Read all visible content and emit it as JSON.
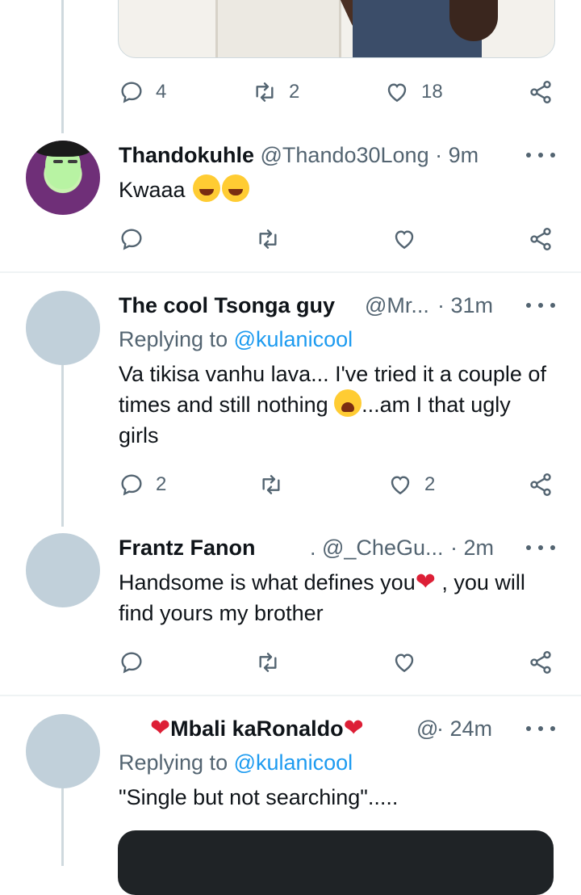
{
  "tweets": [
    {
      "actions": {
        "reply_count": "4",
        "retweet_count": "2",
        "like_count": "18"
      }
    },
    {
      "display_name": "Thandokuhle",
      "handle": "@Thando30Long",
      "time": "· 9m",
      "text": "Kwaaa",
      "emoji": "grinning-squinting-face-emoji",
      "actions": {
        "reply_count": "",
        "retweet_count": "",
        "like_count": ""
      }
    },
    {
      "display_name": "The cool Tsonga guy",
      "handle": "@Mr...",
      "time": "· 31m",
      "replying_to_label": "Replying to",
      "replying_to": "@kulanicool",
      "text_part1": "Va tikisa vanhu lava... I've tried it a couple of times and still nothing",
      "text_part2": "...am I that ugly girls",
      "emoji": "weary-face-emoji",
      "actions": {
        "reply_count": "2",
        "retweet_count": "",
        "like_count": "2"
      }
    },
    {
      "display_name": "Frantz Fanon",
      "handle": ". @_CheGu...",
      "time": "· 2m",
      "text_part1": "Handsome is what defines you",
      "text_part2": " , you will find yours my brother",
      "emoji": "red-heart-emoji",
      "actions": {
        "reply_count": "",
        "retweet_count": "",
        "like_count": ""
      }
    },
    {
      "display_name": "Mbali kaRonaldo",
      "handle": "@",
      "time": "· 24m",
      "replying_to_label": "Replying to",
      "replying_to": "@kulanicool",
      "text": "\"Single but not searching\".....",
      "emoji": "red-heart-emoji"
    }
  ],
  "colors": {
    "text": "#0f1419",
    "meta": "#536471",
    "link": "#1d9bf0",
    "thread_line": "#cfd9de",
    "avatar_placeholder": "#c1d0da",
    "separator": "#eff3f4"
  }
}
